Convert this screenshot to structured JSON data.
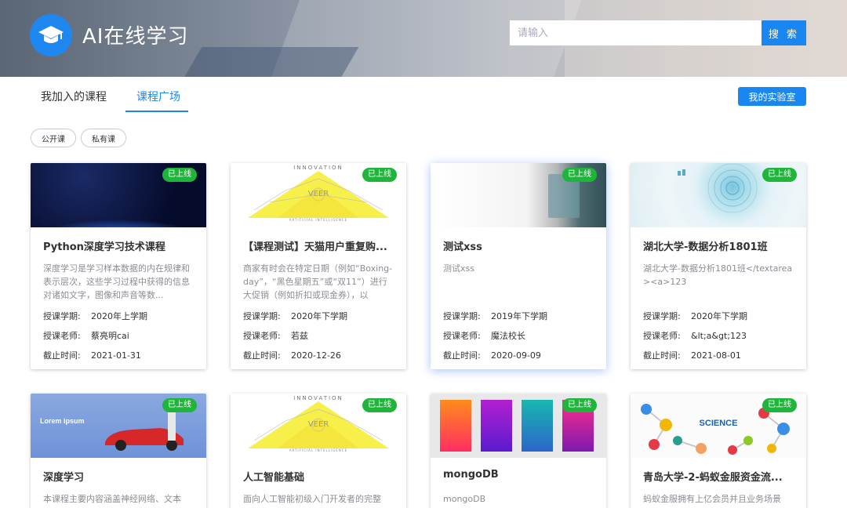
{
  "header": {
    "app_title": "AI在线学习",
    "logo_icon": "graduation-cap-icon",
    "search": {
      "placeholder": "请输入",
      "value": "",
      "button_label": "搜 索"
    }
  },
  "tabs": [
    {
      "label": "我加入的课程",
      "active": false
    },
    {
      "label": "课程广场",
      "active": true
    }
  ],
  "lab_button_label": "我的实验室",
  "filters": [
    "公开课",
    "私有课"
  ],
  "meta_labels": {
    "term": "授课学期:",
    "teacher": "授课老师:",
    "deadline": "截止时间:"
  },
  "courses": [
    {
      "badge": "已上线",
      "title": "Python深度学习技术课程",
      "desc": "深度学习是学习样本数据的内在规律和表示层次，这些学习过程中获得的信息对诸如文字，图像和声音等数...",
      "term": "2020年上学期",
      "teacher": "蔡亮明cai",
      "deadline": "2021-01-31",
      "thumb": "earth"
    },
    {
      "badge": "已上线",
      "title": "【课程测试】天猫用户重复购...",
      "desc": "商家有时会在特定日期（例如“Boxing-day”，“黑色星期五”或“双11”）进行大促销（例如折扣或现金券），以",
      "term": "2020年下学期",
      "teacher": "若兹",
      "deadline": "2020-12-26",
      "thumb": "innovation",
      "thumb_text": "INNOVATION",
      "thumb_sub": "ARTIFICIAL INTELLIGENCE"
    },
    {
      "badge": "已上线",
      "title": "测试xss",
      "desc": "测试xss",
      "term": "2019年下学期",
      "teacher": "魔法校长",
      "deadline": "2020-09-09",
      "thumb": "xss"
    },
    {
      "badge": "已上线",
      "title": "湖北大学-数据分析1801班",
      "desc": "湖北大学-数据分析1801班</textarea><a>123",
      "term": "2020年下学期",
      "teacher": "&lt;a&gt;123",
      "deadline": "2021-08-01",
      "thumb": "data"
    },
    {
      "badge": "已上线",
      "title": "深度学习",
      "desc": "本课程主要内容涵盖神经网络、文本",
      "thumb": "car",
      "thumb_text": "Lorem ipsum"
    },
    {
      "badge": "已上线",
      "title": "人工智能基础",
      "desc": "面向人工智能初级入门开发者的完整",
      "thumb": "innovation",
      "thumb_text": "INNOVATION",
      "thumb_sub": "ARTIFICIAL INTELLIGENCE"
    },
    {
      "badge": "已上线",
      "title": "mongoDB",
      "desc": "mongoDB",
      "thumb": "mongo"
    },
    {
      "badge": "已上线",
      "title": "青岛大学-2-蚂蚁金服资金流...",
      "desc": "蚂蚁金服拥有上亿会员并且业务场景",
      "thumb": "science",
      "thumb_text": "SCIENCE"
    }
  ],
  "colors": {
    "primary": "#1a86f0",
    "badge_green": "#1fb53a"
  }
}
